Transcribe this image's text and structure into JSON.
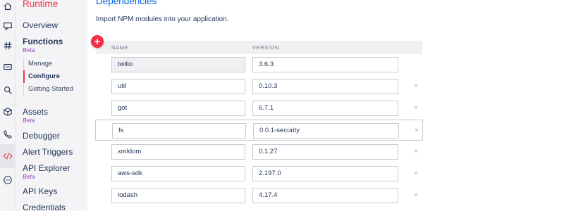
{
  "rail": {
    "icons": [
      "home-icon",
      "chat-bubble-icon",
      "hash-icon",
      "message-icon",
      "search-icon",
      "package-icon",
      "phone-icon",
      "code-icon",
      "more-icon"
    ]
  },
  "sidebar": {
    "header": "Runtime",
    "overview": "Overview",
    "functions": "Functions",
    "functions_badge": "Beta",
    "sub_items": [
      "Manage",
      "Configure",
      "Getting Started"
    ],
    "assets": "Assets",
    "assets_badge": "Beta",
    "debugger": "Debugger",
    "alert_triggers": "Alert Triggers",
    "api_explorer": "API Explorer",
    "api_explorer_badge": "Beta",
    "api_keys": "API Keys",
    "credentials": "Credentials"
  },
  "main": {
    "title": "Dependencies",
    "description": "Import NPM modules into your application.",
    "add_label": "+",
    "columns": {
      "name": "NAME",
      "version": "VERSION"
    },
    "delete_label": "×",
    "rows": [
      {
        "name": "twilio",
        "version": "3.6.3"
      },
      {
        "name": "util",
        "version": "0.10.3"
      },
      {
        "name": "got",
        "version": "6.7.1"
      },
      {
        "name": "fs",
        "version": "0.0.1-security"
      },
      {
        "name": "xmldom",
        "version": "0.1.27"
      },
      {
        "name": "aws-sdk",
        "version": "2.197.0"
      },
      {
        "name": "lodash",
        "version": "4.17.4"
      }
    ]
  },
  "colors": {
    "accent": "#f22f46",
    "link": "#0263e0",
    "beta": "#8b3fc0",
    "text": "#233659"
  }
}
